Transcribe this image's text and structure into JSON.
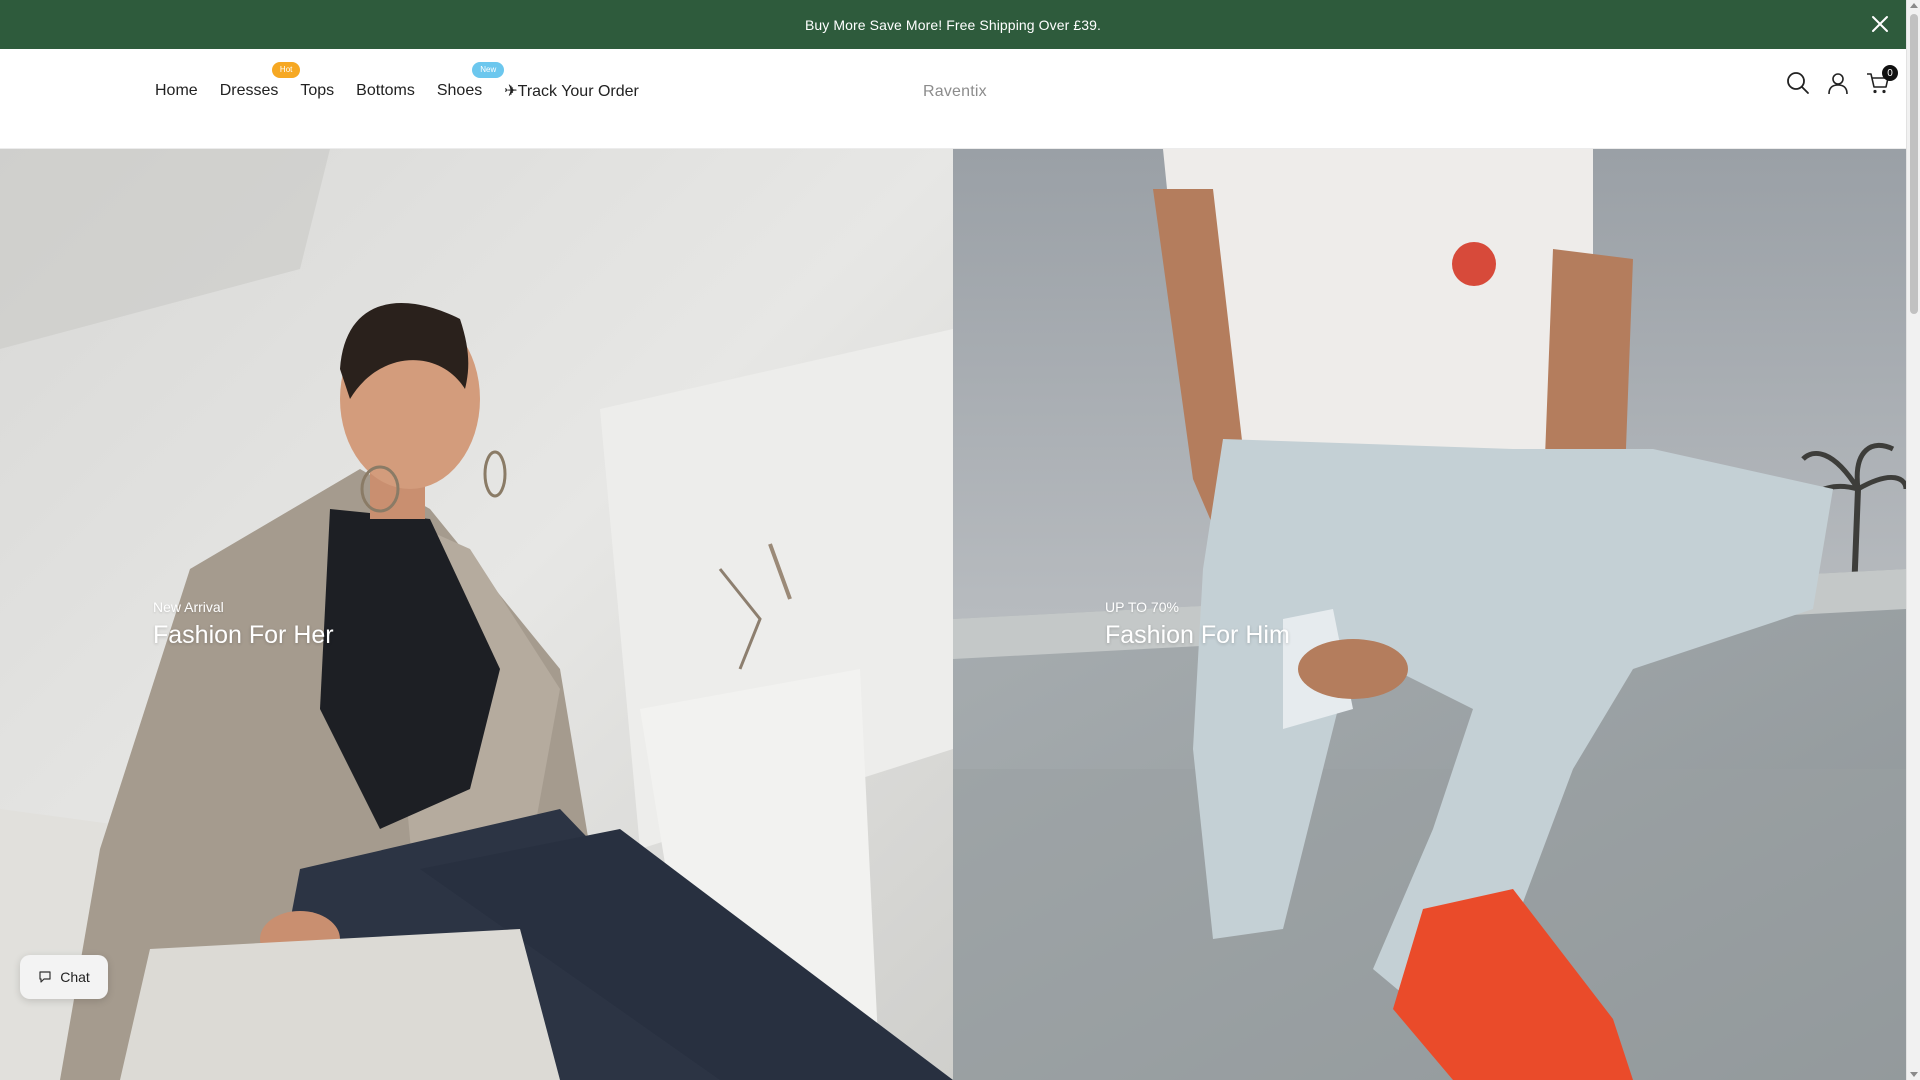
{
  "announcement": {
    "text": "Buy More Save More! Free Shipping Over £39.",
    "close_icon": "close-icon"
  },
  "header": {
    "nav": [
      {
        "label": "Home"
      },
      {
        "label": "Dresses",
        "badge": "Hot"
      },
      {
        "label": "Tops"
      },
      {
        "label": "Bottoms"
      },
      {
        "label": "Shoes",
        "badge": "New"
      },
      {
        "label": "✈Track Your Order"
      }
    ],
    "brand": "Raventix",
    "icons": [
      "search-icon",
      "account-icon",
      "cart-icon"
    ],
    "cart_count": "0"
  },
  "hero": {
    "left": {
      "subtitle": "New Arrival",
      "title": "Fashion For Her"
    },
    "right": {
      "subtitle": "UP TO 70%",
      "title": "Fashion For Him"
    }
  },
  "chat": {
    "label": "Chat",
    "icon": "chat-bubble-icon"
  },
  "colors": {
    "announcement_bg": "#2e5b3c",
    "badge_hot": "#f6a823",
    "badge_new": "#6cc7ee"
  }
}
